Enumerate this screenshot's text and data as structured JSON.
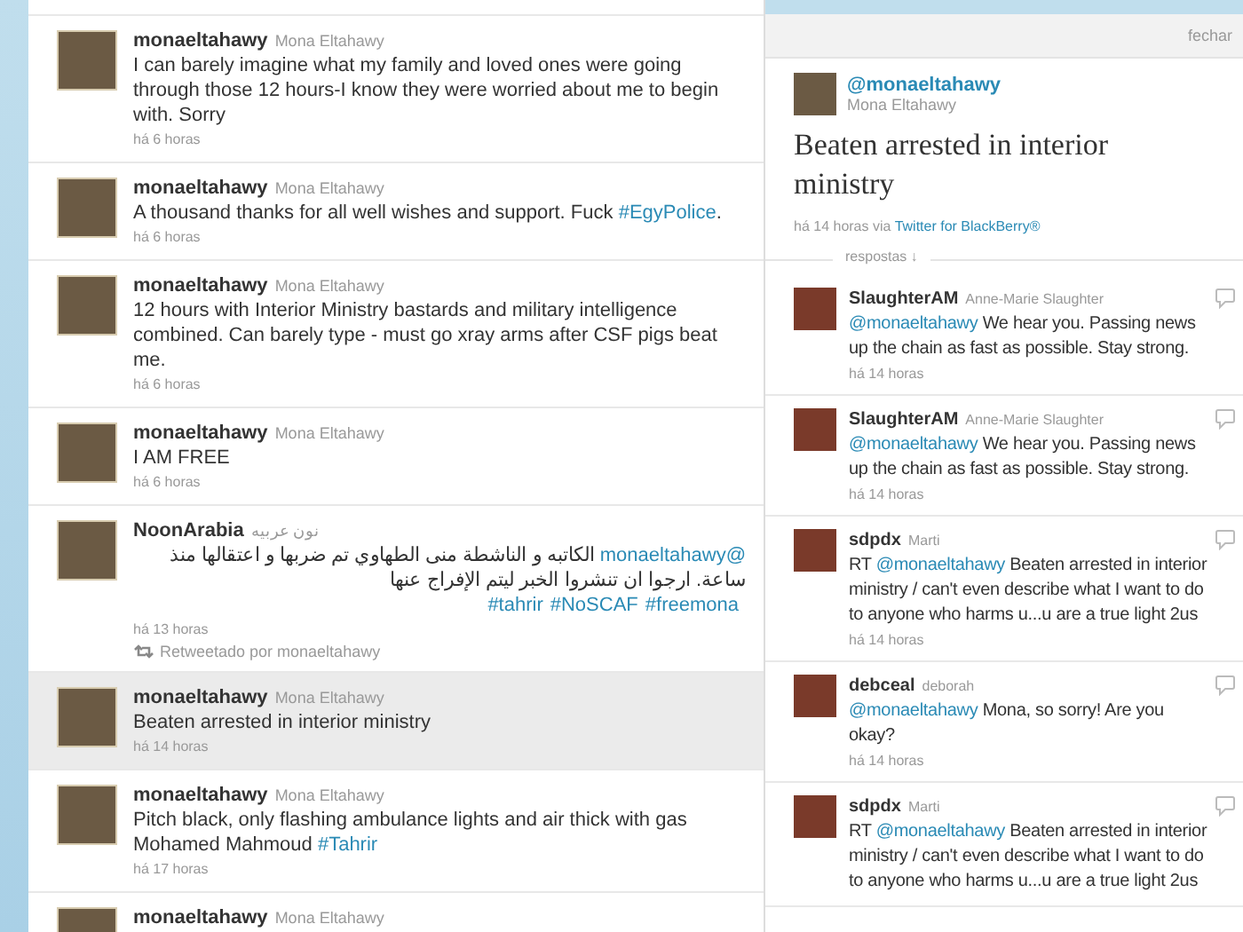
{
  "timeline": {
    "tweets": [
      {
        "username": "monaeltahawy",
        "fullname": "Mona Eltahawy",
        "selected": false,
        "body": [
          {
            "kind": "plain",
            "text": "I can barely imagine what my family and loved ones were going through those 12 hours-I know they were worried about me to begin with. Sorry"
          }
        ],
        "time": "há 6 horas"
      },
      {
        "username": "monaeltahawy",
        "fullname": "Mona Eltahawy",
        "selected": false,
        "body": [
          {
            "kind": "plain",
            "text": "A thousand thanks for all well wishes and support. Fuck "
          },
          {
            "kind": "link",
            "text": "#EgyPolice"
          },
          {
            "kind": "plain",
            "text": "."
          }
        ],
        "time": "há 6 horas"
      },
      {
        "username": "monaeltahawy",
        "fullname": "Mona Eltahawy",
        "selected": false,
        "body": [
          {
            "kind": "plain",
            "text": "12 hours with Interior Ministry bastards and military intelligence combined. Can barely type - must go xray arms after CSF pigs beat me."
          }
        ],
        "time": "há 6 horas"
      },
      {
        "username": "monaeltahawy",
        "fullname": "Mona Eltahawy",
        "selected": false,
        "body": [
          {
            "kind": "plain",
            "text": "I AM FREE"
          }
        ],
        "time": "há 6 horas"
      },
      {
        "username": "NoonArabia",
        "fullname": "نون عربيه",
        "rtl": true,
        "selected": false,
        "body": [
          {
            "kind": "link",
            "text": "@monaeltahawy"
          },
          {
            "kind": "plain",
            "text": " الكاتبه و الناشطة منى الطهاوي تم ضربها و اعتقالها منذ ساعة. ارجوا ان تنشروا الخبر ليتم الإفراج عنها"
          }
        ],
        "tags": [
          "#tahrir",
          "#NoSCAF",
          "#freemona"
        ],
        "time": "há 13 horas",
        "retweeted_by": "Retweetado por monaeltahawy"
      },
      {
        "username": "monaeltahawy",
        "fullname": "Mona Eltahawy",
        "selected": true,
        "body": [
          {
            "kind": "plain",
            "text": "Beaten arrested in interior ministry"
          }
        ],
        "time": "há 14 horas"
      },
      {
        "username": "monaeltahawy",
        "fullname": "Mona Eltahawy",
        "selected": false,
        "body": [
          {
            "kind": "plain",
            "text": "Pitch black, only flashing ambulance lights and air thick with gas Mohamed Mahmoud "
          },
          {
            "kind": "link",
            "text": "#Tahrir"
          }
        ],
        "time": "há 17 horas"
      },
      {
        "username": "monaeltahawy",
        "fullname": "Mona Eltahawy",
        "selected": false
      }
    ]
  },
  "details": {
    "close": "fechar",
    "handle": "@monaeltahawy",
    "fullname": "Mona Eltahawy",
    "text": "Beaten arrested in interior ministry",
    "time": "há 14 horas",
    "via": "via",
    "source": "Twitter for BlackBerry®",
    "replies_label": "respostas ↓",
    "replies": [
      {
        "username": "SlaughterAM",
        "fullname": "Anne-Marie Slaughter",
        "body": [
          {
            "kind": "link",
            "text": "@monaeltahawy"
          },
          {
            "kind": "plain",
            "text": " We hear you. Passing news up the chain as fast as possible. Stay strong."
          }
        ],
        "time": "há 14 horas"
      },
      {
        "username": "SlaughterAM",
        "fullname": "Anne-Marie Slaughter",
        "body": [
          {
            "kind": "link",
            "text": "@monaeltahawy"
          },
          {
            "kind": "plain",
            "text": " We hear you. Passing news up the chain as fast as possible. Stay strong."
          }
        ],
        "time": "há 14 horas"
      },
      {
        "username": "sdpdx",
        "fullname": "Marti",
        "body": [
          {
            "kind": "plain",
            "text": "RT "
          },
          {
            "kind": "link",
            "text": "@monaeltahawy"
          },
          {
            "kind": "plain",
            "text": " Beaten arrested in interior ministry / can't even describe what I want to do to anyone who harms u...u are a true light 2us"
          }
        ],
        "time": "há 14 horas"
      },
      {
        "username": "debceal",
        "fullname": "deborah",
        "body": [
          {
            "kind": "link",
            "text": "@monaeltahawy"
          },
          {
            "kind": "plain",
            "text": " Mona, so sorry! Are you okay?"
          }
        ],
        "time": "há 14 horas"
      },
      {
        "username": "sdpdx",
        "fullname": "Marti",
        "body": [
          {
            "kind": "plain",
            "text": "RT "
          },
          {
            "kind": "link",
            "text": "@monaeltahawy"
          },
          {
            "kind": "plain",
            "text": " Beaten arrested in interior ministry / can't even describe what I want to do to anyone who harms u...u are a true light 2us"
          }
        ]
      }
    ]
  }
}
